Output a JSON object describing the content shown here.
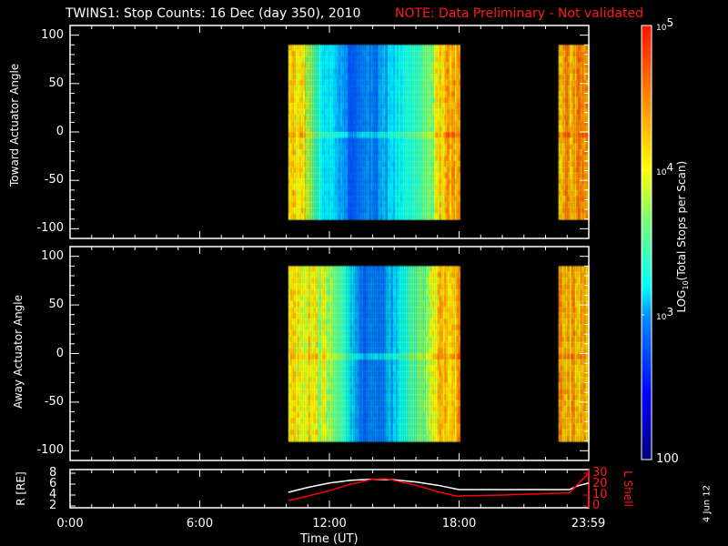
{
  "title": "TWINS1: Stop Counts: 16 Dec (day 350), 2010",
  "note": "NOTE: Data Preliminary - Not validated",
  "side_stamp": "4 Jun 12",
  "chart_data": [
    {
      "type": "heatmap",
      "name": "toward",
      "ylabel": "Toward Actuator Angle",
      "ylim": [
        -110,
        110
      ],
      "yticks": [
        "100",
        "50",
        "0",
        "-50",
        "-100"
      ],
      "ytick_values": [
        100,
        50,
        0,
        -50,
        -100
      ],
      "data_angle_range": [
        -90,
        90
      ],
      "xlim_hours": [
        0,
        24
      ],
      "log10_profile": [
        [
          10.1,
          4.3
        ],
        [
          10.8,
          3.9
        ],
        [
          11.5,
          3.3
        ],
        [
          13.0,
          2.85
        ],
        [
          14.7,
          3.05
        ],
        [
          16.5,
          3.6
        ],
        [
          17.3,
          4.3
        ],
        [
          18.0,
          null
        ],
        [
          22.6,
          4.4
        ],
        [
          24.0,
          null
        ]
      ]
    },
    {
      "type": "heatmap",
      "name": "away",
      "ylabel": "Away Actuator Angle",
      "ylim": [
        -110,
        110
      ],
      "yticks": [
        "100",
        "50",
        "0",
        "-50",
        "-100"
      ],
      "ytick_values": [
        100,
        50,
        0,
        -50,
        -100
      ],
      "data_angle_range": [
        -90,
        90
      ],
      "xlim_hours": [
        0,
        24
      ],
      "log10_profile": [
        [
          10.1,
          4.2
        ],
        [
          11.7,
          3.9
        ],
        [
          12.7,
          3.35
        ],
        [
          13.5,
          2.85
        ],
        [
          15.0,
          3.1
        ],
        [
          16.5,
          3.8
        ],
        [
          17.3,
          4.3
        ],
        [
          18.0,
          null
        ],
        [
          22.6,
          4.3
        ],
        [
          24.0,
          null
        ]
      ]
    },
    {
      "type": "line",
      "name": "orbit",
      "ylabel_left": "R [RE]",
      "ylabel_right": "L Shell",
      "ylim_left": [
        2,
        8
      ],
      "ylim_right": [
        0,
        30
      ],
      "yticks_left": [
        "8",
        "6",
        "4",
        "2"
      ],
      "yticks_right": [
        "30",
        "20",
        "10",
        "0"
      ],
      "xlabel": "Time (UT)",
      "xticks": [
        "0:00",
        "6:00",
        "12:00",
        "18:00",
        "23:59"
      ],
      "xtick_values": [
        0,
        6,
        12,
        18,
        23.98
      ],
      "series": [
        {
          "name": "R",
          "color": "#ffffff",
          "axis": "left",
          "x": [
            10.1,
            11,
            12,
            13,
            14,
            15,
            16,
            17,
            18,
            20,
            23.1,
            23.5,
            24
          ],
          "y": [
            4.5,
            5.4,
            6.2,
            6.7,
            6.9,
            6.8,
            6.4,
            5.8,
            5.0,
            5.0,
            5.0,
            5.7,
            6.2
          ]
        },
        {
          "name": "L Shell",
          "color": "#ff0000",
          "axis": "right",
          "x": [
            10.1,
            11,
            12,
            13,
            14,
            14.6,
            16,
            17,
            17.9,
            20,
            23.1,
            24
          ],
          "y": [
            5,
            9,
            14,
            20,
            24.5,
            25,
            19,
            13,
            9,
            10,
            12,
            30
          ]
        }
      ]
    }
  ],
  "colorbar": {
    "label": "LOG10(Total Stops per Scan)",
    "label_main": "LOG",
    "label_sub": "10",
    "label_rest": "(Total Stops per Scan)",
    "ticks": [
      {
        "base": "10",
        "exp": "5",
        "value": 5
      },
      {
        "base": "10",
        "exp": "4",
        "value": 4
      },
      {
        "base": "10",
        "exp": "3",
        "value": 3
      },
      {
        "base": "100",
        "exp": "",
        "value": 2
      }
    ],
    "range_log10": [
      2,
      5
    ]
  }
}
